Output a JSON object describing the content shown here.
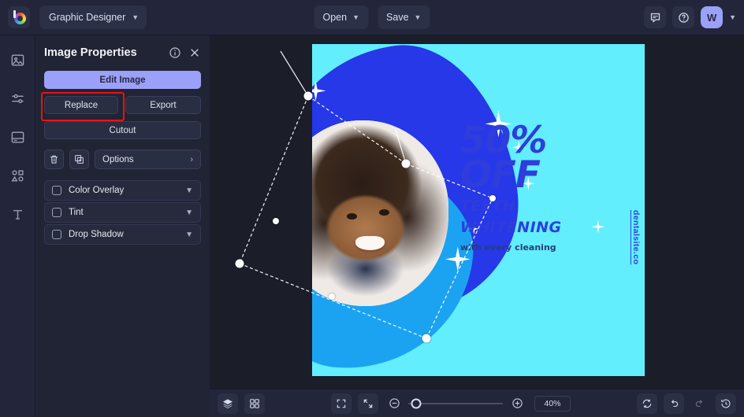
{
  "topbar": {
    "logo_name": "burner-logo",
    "app_tab": "Graphic Designer",
    "open_label": "Open",
    "save_label": "Save",
    "chat_icon": "comment-icon",
    "help_icon": "help-circle-icon",
    "avatar_initial": "W"
  },
  "rail": {
    "items": [
      {
        "icon": "image-icon",
        "label": "Image"
      },
      {
        "icon": "adjustments-icon",
        "label": "Adjust"
      },
      {
        "icon": "layout-icon",
        "label": "Layout"
      },
      {
        "icon": "shapes-icon",
        "label": "Shapes"
      },
      {
        "icon": "text-icon",
        "label": "Text"
      }
    ]
  },
  "panel": {
    "title": "Image Properties",
    "info_icon": "info-circle-icon",
    "close_icon": "close-icon",
    "edit_image_label": "Edit Image",
    "replace_label": "Replace",
    "export_label": "Export",
    "cutout_label": "Cutout",
    "delete_icon": "trash-icon",
    "duplicate_icon": "duplicate-icon",
    "options_label": "Options",
    "highlight_color": "#ee1111",
    "accent_color": "#9ba0f8",
    "effects": [
      {
        "label": "Color Overlay",
        "checked": false
      },
      {
        "label": "Tint",
        "checked": false
      },
      {
        "label": "Drop Shadow",
        "checked": false
      }
    ]
  },
  "canvas": {
    "background_color": "#62eefc",
    "blob_dark_color": "#2638e8",
    "blob_mid_color": "#1ba3f2",
    "headline_1": "50%",
    "headline_2": "OFF",
    "headline_3": "TEETH",
    "headline_4": "WHITENING",
    "subtext": "with every cleaning",
    "website": "dentalsite.co",
    "text_color": "#2f3ddd"
  },
  "bottombar": {
    "layers_icon": "layers-icon",
    "grid_icon": "grid-icon",
    "fit_icon": "fit-screen-icon",
    "collapse_icon": "collapse-icon",
    "zoom_out_icon": "zoom-out-icon",
    "zoom_in_icon": "zoom-in-icon",
    "zoom_level": "40%",
    "sync_icon": "sync-icon",
    "undo_icon": "undo-icon",
    "redo_icon": "redo-icon",
    "history_icon": "history-icon"
  }
}
